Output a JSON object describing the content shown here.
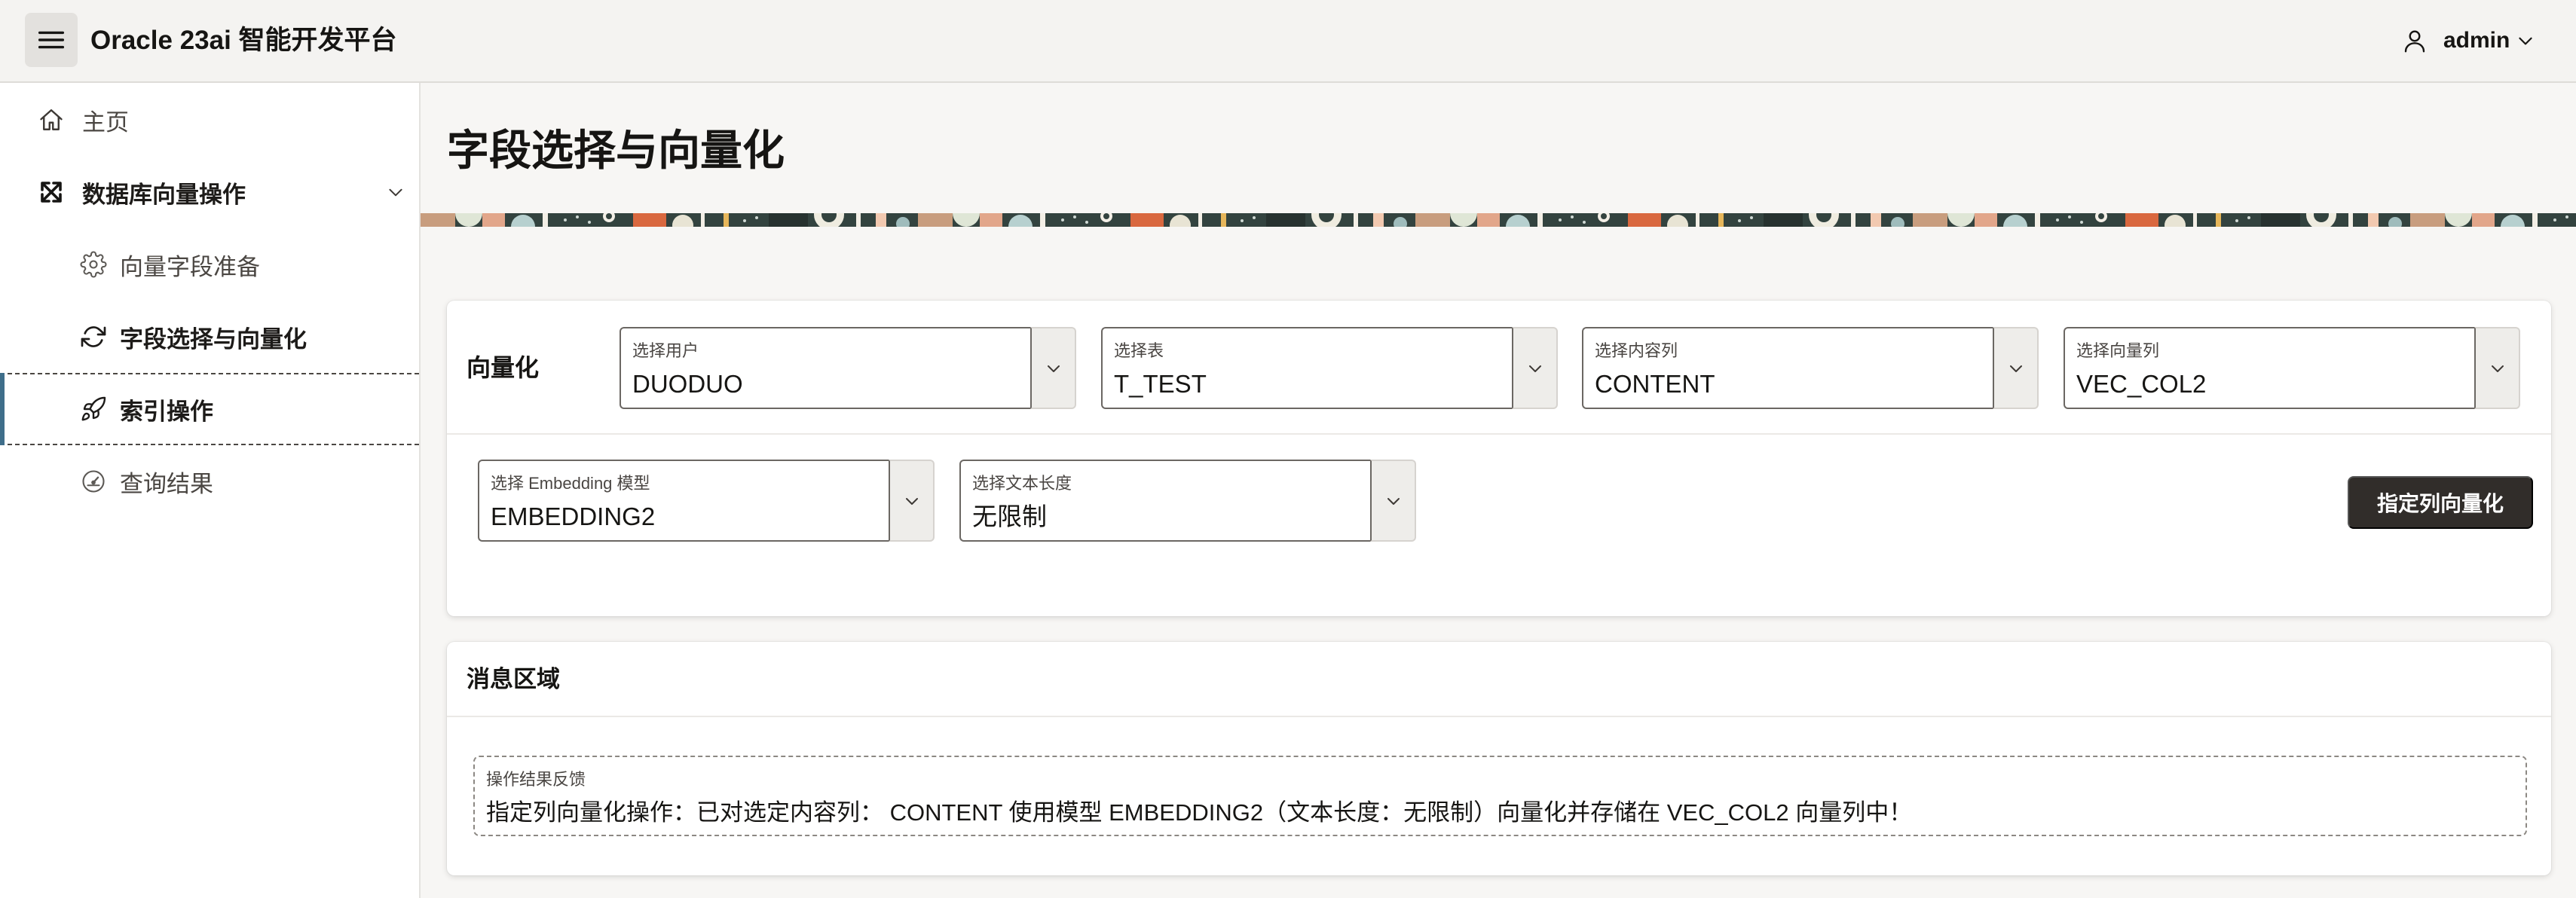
{
  "header": {
    "menu_icon": "hamburger-menu-icon",
    "title": "Oracle 23ai 智能开发平台",
    "user_icon": "user-icon",
    "user_name": "admin"
  },
  "sidebar": {
    "items": [
      {
        "label": "主页",
        "icon": "home-icon"
      },
      {
        "label": "数据库向量操作",
        "icon": "expand-arrows-icon",
        "expanded": true,
        "children": [
          {
            "label": "向量字段准备",
            "icon": "gear-icon"
          },
          {
            "label": "字段选择与向量化",
            "icon": "refresh-icon"
          },
          {
            "label": "索引操作",
            "icon": "rocket-icon",
            "selected": true
          },
          {
            "label": "查询结果",
            "icon": "gauge-icon"
          }
        ]
      }
    ]
  },
  "page": {
    "title": "字段选择与向量化"
  },
  "vectorize_region": {
    "title": "向量化",
    "selects": [
      {
        "label": "选择用户",
        "value": "DUODUO"
      },
      {
        "label": "选择表",
        "value": "T_TEST"
      },
      {
        "label": "选择内容列",
        "value": "CONTENT"
      },
      {
        "label": "选择向量列",
        "value": "VEC_COL2"
      },
      {
        "label": "选择 Embedding 模型",
        "value": "EMBEDDING2"
      },
      {
        "label": "选择文本长度",
        "value": "无限制"
      }
    ],
    "button_label": "指定列向量化"
  },
  "message_region": {
    "title": "消息区域",
    "feedback_label": "操作结果反馈",
    "feedback_text": "指定列向量化操作：已对选定内容列： CONTENT 使用模型 EMBEDDING2（文本长度：无限制）向量化并存储在 VEC_COL2 向量列中！"
  },
  "colors": {
    "header_bg": "#f4f3f1",
    "page_bg": "#f7f6f4",
    "primary_button": "#312d2a",
    "selected_indicator": "#3f6e8a"
  }
}
